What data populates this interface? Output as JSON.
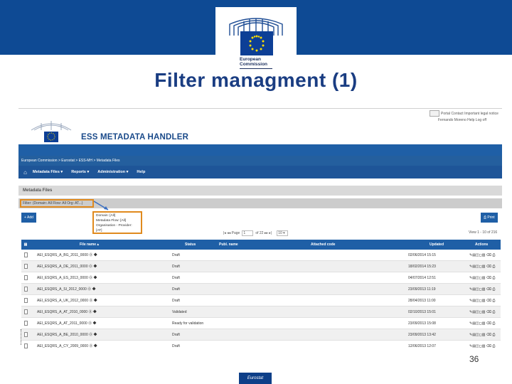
{
  "banner": {
    "logo_text_line1": "European",
    "logo_text_line2": "Commission",
    "accent_color": "#0e4a94"
  },
  "slide": {
    "title": "Filter managment (1)",
    "page_number": "36",
    "footer_label": "Eurostat"
  },
  "app": {
    "logo_line1": "EUROPEAN",
    "logo_line2": "COMMISSION",
    "title": "ESS METADATA HANDLER",
    "top_links_line1": "Portal   Contact   Important legal notice",
    "top_links_line2": "Fernando Moreno  Help  Log off",
    "breadcrumb": "European Commission > Eurostat > ESS-MH > Metadata Files",
    "nav": [
      {
        "label": "Metadata Files",
        "has_caret": true
      },
      {
        "label": "Reports",
        "has_caret": true
      },
      {
        "label": "Administration",
        "has_caret": true
      },
      {
        "label": "Help",
        "has_caret": false
      }
    ],
    "section_title": "Metadata Files",
    "filter_summary": "Filter: (Domain: All  Flow: All  Org: AT...)",
    "tooltip": [
      "Domain: [All]",
      "Metadata Flow: [All]",
      "Organisation - Provider: [AT]"
    ],
    "add_button": "+ Add",
    "print_button": "Print",
    "pager": {
      "page_label": "Page",
      "page_value": "1",
      "of_label": "of 22",
      "per_page": "10"
    },
    "view_info": "View 1 - 10 of 216",
    "columns": [
      "File name",
      "Status",
      "Publ. name",
      "Attached code",
      "Updated",
      "Actions"
    ],
    "rows": [
      {
        "file": "AEI_ESQRS_A_BG_2011_0000",
        "status": "Draft",
        "updated": "02/06/2014 15:15"
      },
      {
        "file": "AEI_ESQRS_A_DE_2011_0000",
        "status": "Draft",
        "updated": "18/02/2014 15:23"
      },
      {
        "file": "AEI_ESQRS_A_ES_2013_0000",
        "status": "Draft",
        "updated": "04/07/2014 12:51"
      },
      {
        "file": "AEI_ESQRS_A_SI_2012_0000",
        "status": "Draft",
        "updated": "23/09/2013 11:19"
      },
      {
        "file": "AEI_ESQRS_A_UK_2012_0000",
        "status": "Draft",
        "updated": "28/04/2013 11:00"
      },
      {
        "file": "AEI_ESQRS_A_AT_2010_0000",
        "status": "Validated",
        "updated": "02/10/2013 15:01"
      },
      {
        "file": "AEI_ESQRS_A_AT_2011_0000",
        "status": "Ready for validation",
        "updated": "23/09/2013 15:08"
      },
      {
        "file": "AEI_ESQRS_A_BE_2010_0000",
        "status": "Draft",
        "updated": "23/09/2013 13:42"
      },
      {
        "file": "AEI_ESQRS_A_CY_2009_0000",
        "status": "Draft",
        "updated": "12/06/2013 12:07"
      }
    ],
    "actions_glyphs": "✎▤◫◻▥ ⌫ ⎙"
  }
}
